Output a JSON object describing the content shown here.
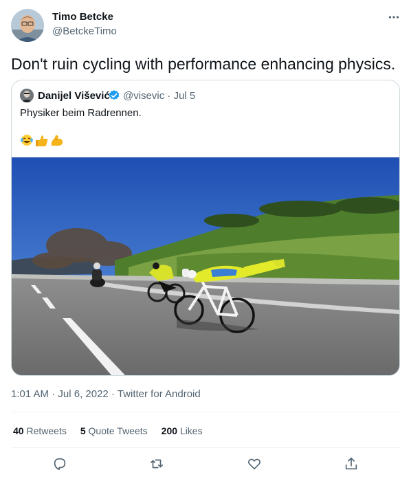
{
  "tweet": {
    "author": {
      "name": "Timo Betcke",
      "handle": "@BetckeTimo"
    },
    "text": "Don't ruin cycling with performance enhancing physics.",
    "quoted": {
      "name": "Danijel Višević",
      "handle": "@visevic",
      "date": "Jul 5",
      "text": "Physiker beim Radrennen.",
      "emojis": [
        "laughing-tears",
        "thumbs-up",
        "flexed-biceps"
      ]
    },
    "meta": {
      "time": "1:01 AM",
      "date": "Jul 6, 2022",
      "source": "Twitter for Android"
    },
    "stats": {
      "retweets_count": "40",
      "retweets_label": "Retweets",
      "quotes_count": "5",
      "quotes_label": "Quote Tweets",
      "likes_count": "200",
      "likes_label": "Likes"
    }
  },
  "icons": [
    "more-icon",
    "verified-badge-icon",
    "reply-icon",
    "retweet-icon",
    "like-icon",
    "share-icon"
  ],
  "colors": {
    "text": "#0f1419",
    "secondary": "#536471",
    "border": "#cfd9de",
    "verified": "#1d9bf0"
  }
}
